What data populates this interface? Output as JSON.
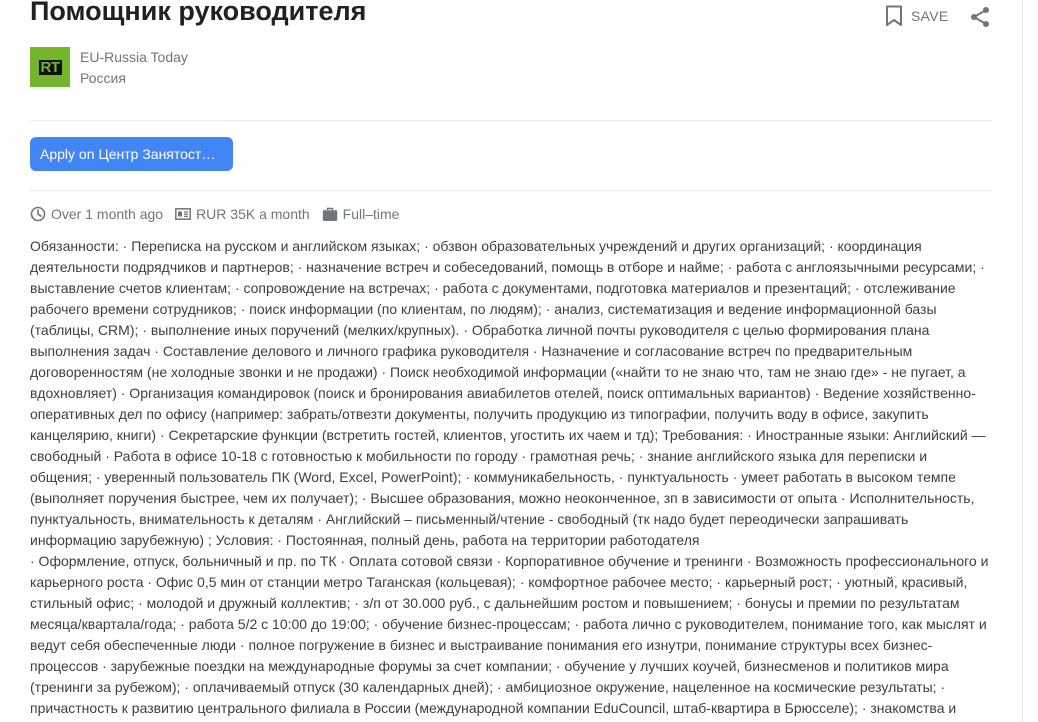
{
  "job": {
    "title": "Помощник руководителя",
    "save_label": "SAVE",
    "company": "EU-Russia Today",
    "location": "Россия",
    "logo_text": "RT",
    "apply_label": "Apply on Центр Занятост…"
  },
  "meta": {
    "posted": "Over 1 month ago",
    "salary": "RUR 35K a month",
    "employment_type": "Full–time"
  },
  "description": {
    "paragraph_1": "Обязанности: · Переписка на русском и английском языках; · обзвон образовательных учреждений и других организаций; · координация деятельности подрядчиков и партнеров; · назначение встреч и собеседований, помощь в отборе и найме; · работа с англоязычными ресурсами; · выставление счетов клиентам; · сопровождение на встречах; · работа с документами, подготовка материалов и презентаций; · отслеживание рабочего времени сотрудников; · поиск информации (по клиентам, по людям); · анализ, систематизация и ведение информационной базы (таблицы, CRM); · выполнение иных поручений (мелких/крупных). · Обработка личной почты руководителя с целью формирования плана выполнения задач · Составление делового и личного графика руководителя · Назначение и согласование встреч по предварительным договоренностям (не холодные звонки и не продажи) · Поиск необходимой информации («найти то не знаю что, там не знаю где» - не пугает, а вдохновляет) · Организация командировок (поиск и бронирования авиабилетов отелей, поиск оптимальных вариантов) · Ведение хозяйственно-оперативных дел по офису (например: забрать/отвезти документы, получить продукцию из типографии, получить воду в офисе, закупить канцелярию, книги) · Секретарские функции (встретить гостей, клиентов, угостить их чаем и тд); Требования: · Иностранные языки: Английский — свободный · Работа в офисе 10-18 с готовностью к мобильности по городу · грамотная речь; · знание английского языка для переписки и общения; · уверенный пользователь ПК (Word, Excel, PowerPoint); · коммуникабельность, · пунктуальность · умеет работать в высоком темпе (выполняет поручения быстрее, чем их получает); · Высшее образования, можно неоконченное, зп в зависимости от опыта · Исполнительность, пунктуальность, внимательность к деталям · Английский – письменный/чтение - свободный (тк надо будет переодически запрашивать информацию зарубежную) ; Условия: · Постоянная, полный день, работа на территории работодателя",
    "paragraph_2": "· Оформление, отпуск, больничный и пр. по ТК · Оплата сотовой связи · Корпоративное обучение и тренинги · Возможность профессионального и карьерного роста · Офис 0,5 мин от станции метро Таганская (кольцевая); · комфортное рабочее место; · карьерный рост; · уютный, красивый, стильный офис; · молодой и дружный коллектив; · з/п от 30.000 руб., с дальнейшим ростом и повышением; · бонусы и премии по результатам месяца/квартала/года; · работа 5/2 с 10:00 до 19:00; · обучение бизнес-процессам; · работа лично с руководителем, понимание того, как мыслят и ведут себя обеспеченные люди · полное погружение в бизнес и выстраивание понимания его изнутри, понимание структуры всех бизнес-процессов · зарубежные поездки на международные форумы за счет компании; · обучение у лучших коучей, бизнесменов и политиков мира (тренинги за рубежом); · оплачиваемый отпуск (30 календарных дней); · амбициозное окружение, нацеленное на космические результаты; · причастность к развитию центрального филиала в России (международной компании EduCouncil, штаб-квартира в Брюсселе); · знакомства и"
  },
  "icons": {
    "save": "bookmark-icon",
    "share": "share-icon",
    "posted": "clock-icon",
    "salary": "money-icon",
    "employment": "briefcase-icon"
  },
  "colors": {
    "apply_button": "#4285f4",
    "logo_background": "#74b52c",
    "muted_text": "#70757a"
  }
}
